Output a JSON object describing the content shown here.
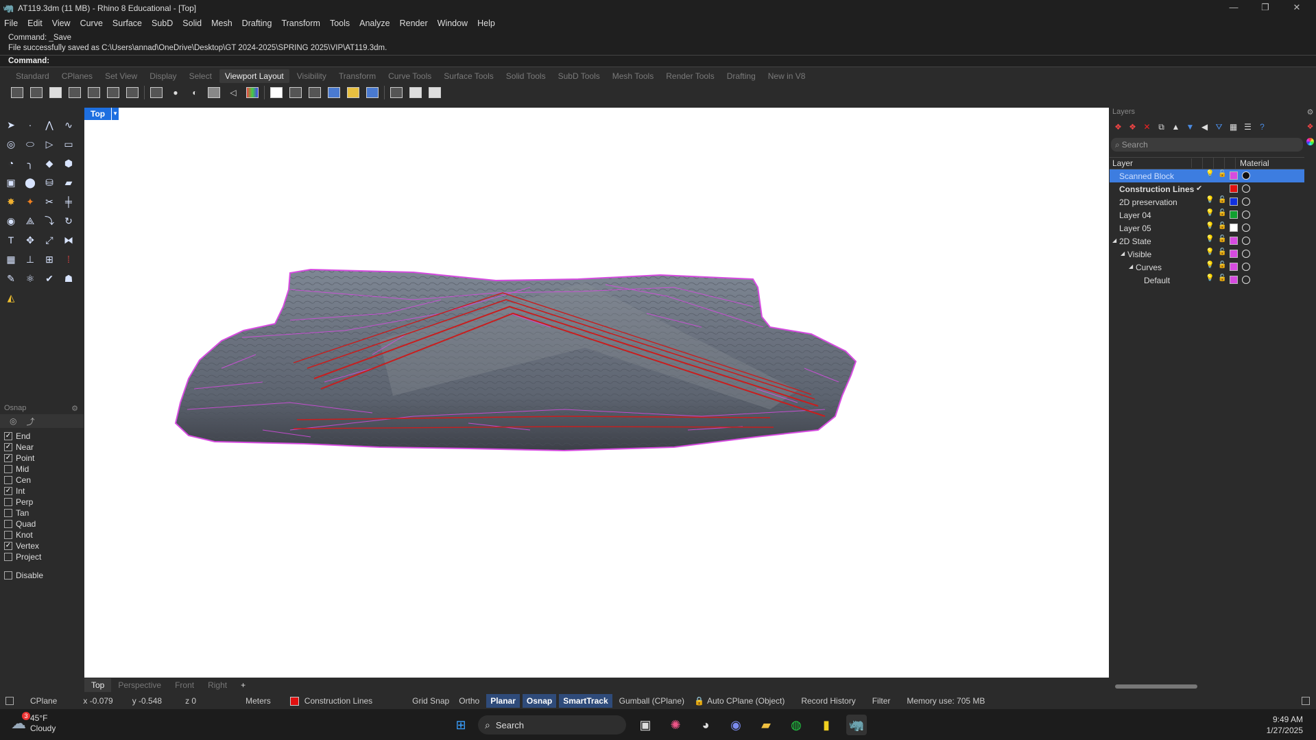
{
  "window": {
    "title": "AT119.3dm (11 MB) - Rhino 8 Educational - [Top]",
    "minimize": "—",
    "maximize": "❐",
    "close": "✕"
  },
  "menu": [
    "File",
    "Edit",
    "View",
    "Curve",
    "Surface",
    "SubD",
    "Solid",
    "Mesh",
    "Drafting",
    "Transform",
    "Tools",
    "Analyze",
    "Render",
    "Window",
    "Help"
  ],
  "command": {
    "history_1": "Command: _Save",
    "history_2": "File successfully saved as C:\\Users\\annad\\OneDrive\\Desktop\\GT 2024-2025\\SPRING 2025\\VIP\\AT119.3dm.",
    "prompt": "Command:"
  },
  "toolbar_tabs": [
    "Standard",
    "CPlanes",
    "Set View",
    "Display",
    "Select",
    "Viewport Layout",
    "Visibility",
    "Transform",
    "Curve Tools",
    "Surface Tools",
    "Solid Tools",
    "SubD Tools",
    "Mesh Tools",
    "Render Tools",
    "Drafting",
    "New in V8"
  ],
  "active_tab": "Viewport Layout",
  "viewport": {
    "label": "Top",
    "tabs": [
      "Top",
      "Perspective",
      "Front",
      "Right"
    ],
    "active": "Top",
    "add": "+"
  },
  "osnap": {
    "title": "Osnap",
    "items": [
      {
        "label": "End",
        "checked": true
      },
      {
        "label": "Near",
        "checked": true
      },
      {
        "label": "Point",
        "checked": true
      },
      {
        "label": "Mid",
        "checked": false
      },
      {
        "label": "Cen",
        "checked": false
      },
      {
        "label": "Int",
        "checked": true
      },
      {
        "label": "Perp",
        "checked": false
      },
      {
        "label": "Tan",
        "checked": false
      },
      {
        "label": "Quad",
        "checked": false
      },
      {
        "label": "Knot",
        "checked": false
      },
      {
        "label": "Vertex",
        "checked": true
      },
      {
        "label": "Project",
        "checked": false
      }
    ],
    "disable": "Disable"
  },
  "layers": {
    "title": "Layers",
    "search_placeholder": "Search",
    "col_layer": "Layer",
    "col_material": "Material",
    "rows": [
      {
        "name": "Scanned Block",
        "color": "#d64be0",
        "selected": true,
        "bold": false,
        "indent": 0
      },
      {
        "name": "Construction Lines",
        "color": "#e01010",
        "selected": false,
        "bold": true,
        "indent": 0
      },
      {
        "name": "2D preservation",
        "color": "#1030e0",
        "selected": false,
        "bold": false,
        "indent": 0
      },
      {
        "name": "Layer 04",
        "color": "#10a030",
        "selected": false,
        "bold": false,
        "indent": 0
      },
      {
        "name": "Layer 05",
        "color": "#ffffff",
        "selected": false,
        "bold": false,
        "indent": 0
      },
      {
        "name": "2D State",
        "color": "#d64be0",
        "selected": false,
        "bold": false,
        "indent": 0
      },
      {
        "name": "Visible",
        "color": "#d64be0",
        "selected": false,
        "bold": false,
        "indent": 1
      },
      {
        "name": "Curves",
        "color": "#d64be0",
        "selected": false,
        "bold": false,
        "indent": 2
      },
      {
        "name": "Default",
        "color": "#d64be0",
        "selected": false,
        "bold": false,
        "indent": 3
      }
    ]
  },
  "status": {
    "cplane": "CPlane",
    "x": "x -0.079",
    "y": "y -0.548",
    "z": "z 0",
    "units": "Meters",
    "layer": "Construction Lines",
    "grid_snap": "Grid Snap",
    "ortho": "Ortho",
    "planar": "Planar",
    "osnap": "Osnap",
    "smarttrack": "SmartTrack",
    "gumball": "Gumball (CPlane)",
    "auto_cplane": "Auto CPlane (Object)",
    "record_history": "Record History",
    "filter": "Filter",
    "memory": "Memory use: 705 MB"
  },
  "taskbar": {
    "weather_temp": "45°F",
    "weather_desc": "Cloudy",
    "weather_badge": "3",
    "search": "Search",
    "time": "9:49 AM",
    "date": "1/27/2025"
  },
  "colors": {
    "accent": "#1e6fe0",
    "curve_magenta": "#d64be0",
    "curve_red": "#c81e1e"
  }
}
